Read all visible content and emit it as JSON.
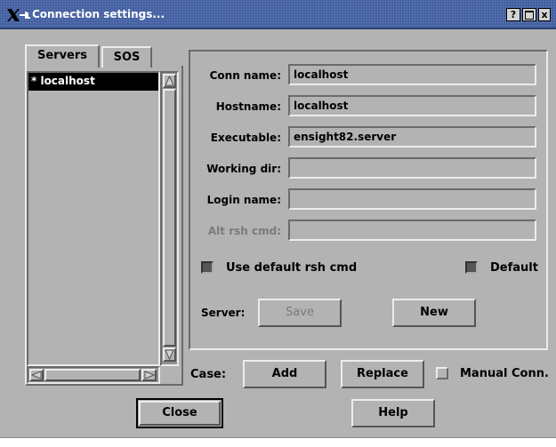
{
  "window": {
    "title": "Connection settings...",
    "help_button": "?",
    "maximize_button": "□",
    "close_button": "x"
  },
  "tabs": [
    {
      "label": "Servers",
      "active": true
    },
    {
      "label": "SOS",
      "active": false
    }
  ],
  "server_list": {
    "items": [
      "* localhost"
    ],
    "selected_index": 0
  },
  "form": {
    "conn_name": {
      "label": "Conn name:",
      "value": "localhost"
    },
    "hostname": {
      "label": "Hostname:",
      "value": "localhost"
    },
    "executable": {
      "label": "Executable:",
      "value": "ensight82.server"
    },
    "working_dir": {
      "label": "Working dir:",
      "value": ""
    },
    "login_name": {
      "label": "Login name:",
      "value": ""
    },
    "alt_rsh_cmd": {
      "label": "Alt rsh cmd:",
      "value": "",
      "disabled": true
    }
  },
  "checkboxes": {
    "use_default_rsh": {
      "label": "Use default rsh cmd",
      "checked": true
    },
    "default": {
      "label": "Default",
      "checked": true
    },
    "manual_conn": {
      "label": "Manual Conn.",
      "checked": false
    }
  },
  "server_row": {
    "label": "Server:",
    "save": "Save",
    "new": "New"
  },
  "case_row": {
    "label": "Case:",
    "add": "Add",
    "replace": "Replace"
  },
  "bottom": {
    "close": "Close",
    "help": "Help"
  },
  "colors": {
    "title_bg": "#3c5a9e",
    "panel_bg": "#b3b3b3",
    "selection_bg": "#000000",
    "disabled_text": "#7a7a7a"
  }
}
